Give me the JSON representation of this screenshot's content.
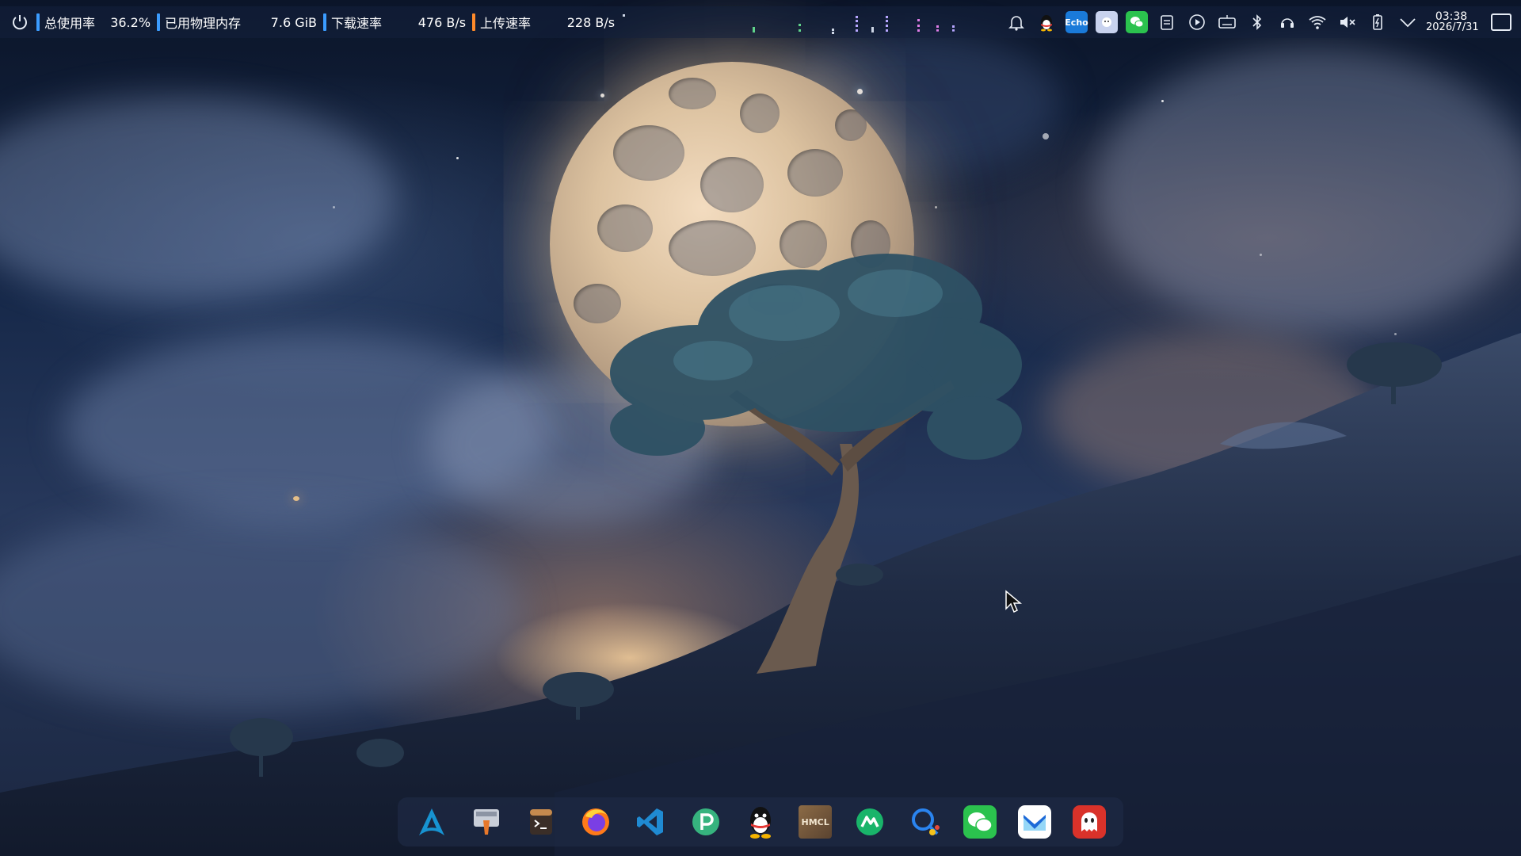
{
  "topbar": {
    "stats": [
      {
        "label": "总使用率",
        "value": "36.2%",
        "color": "#3b9cff"
      },
      {
        "label": "已用物理内存",
        "value": "7.6 GiB",
        "color": "#3b9cff"
      },
      {
        "label": "下载速率",
        "value": "476 B/s",
        "color": "#3b9cff"
      },
      {
        "label": "上传速率",
        "value": "228 B/s",
        "color": "#ff8a2a"
      }
    ],
    "tray_icons": [
      "bell-icon",
      "qq-icon",
      "echo-icon",
      "ghost-app-icon",
      "wechat-icon",
      "clipboard-icon",
      "media-play-icon",
      "keyboard-icon",
      "bluetooth-icon",
      "headset-icon",
      "wifi-icon",
      "volume-muted-icon",
      "battery-icon",
      "chevron-down-icon"
    ],
    "echo_label": "Echo",
    "clock": {
      "time": "03:38",
      "date": "2026/7/31"
    }
  },
  "dock": {
    "apps": [
      "arch-launcher",
      "screenshot-tool",
      "terminal",
      "firefox",
      "vscode",
      "p-app",
      "qq",
      "hmcl",
      "arc-app",
      "search-app",
      "wechat",
      "mail-app",
      "ghost-app"
    ],
    "hmcl_label": "HMCL"
  }
}
